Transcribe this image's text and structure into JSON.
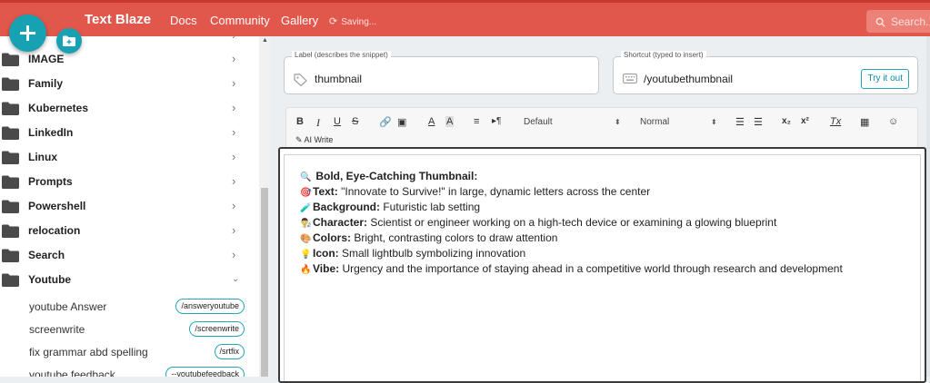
{
  "header": {
    "brand": "Text Blaze",
    "nav": [
      "Docs",
      "Community",
      "Gallery"
    ],
    "status": "Saving...",
    "search_placeholder": "Search..."
  },
  "sidebar": {
    "folders": [
      {
        "label": "IMAGE",
        "expanded": false
      },
      {
        "label": "Family",
        "expanded": false
      },
      {
        "label": "Kubernetes",
        "expanded": false
      },
      {
        "label": "LinkedIn",
        "expanded": false
      },
      {
        "label": "Linux",
        "expanded": false
      },
      {
        "label": "Prompts",
        "expanded": false
      },
      {
        "label": "Powershell",
        "expanded": false
      },
      {
        "label": "relocation",
        "expanded": false
      },
      {
        "label": "Search",
        "expanded": false
      },
      {
        "label": "Youtube",
        "expanded": true
      }
    ],
    "snippets": [
      {
        "label": "youtube Answer",
        "shortcut": "/answeryoutube"
      },
      {
        "label": "screenwrite",
        "shortcut": "/screenwrite"
      },
      {
        "label": "fix grammar abd spelling",
        "shortcut": "/srtfix"
      },
      {
        "label": "youtube feedback",
        "shortcut": "--youtubefeedback"
      }
    ]
  },
  "snippet_form": {
    "label_legend": "Label (describes the snippet)",
    "label_value": "thumbnail",
    "shortcut_legend": "Shortcut (typed to insert)",
    "shortcut_value": "/youtubethumbnail",
    "try_button": "Try it out"
  },
  "toolbar": {
    "font_select": "Default",
    "size_select": "Normal",
    "ai_write": "AI Write",
    "buttons": [
      "B",
      "I",
      "U",
      "S",
      "x₂",
      "x²",
      "Tx"
    ]
  },
  "editor": {
    "heading_emoji": "🔍",
    "heading": "Bold, Eye-Catching Thumbnail:",
    "lines": [
      {
        "emoji": "🎯",
        "key": "Text:",
        "value": " \"Innovate to Survive!\" in large, dynamic letters across the center"
      },
      {
        "emoji": "🧪",
        "key": "Background:",
        "value": " Futuristic lab setting"
      },
      {
        "emoji": "👨‍🔬",
        "key": "Character:",
        "value": " Scientist or engineer working on a high-tech device or examining a glowing blueprint"
      },
      {
        "emoji": "🎨",
        "key": "Colors:",
        "value": " Bright, contrasting colors to draw attention"
      },
      {
        "emoji": "💡",
        "key": "Icon:",
        "value": " Small lightbulb symbolizing innovation"
      },
      {
        "emoji": "🔥",
        "key": "Vibe:",
        "value": " Urgency and the importance of staying ahead in a competitive world through research and development"
      }
    ]
  },
  "colors": {
    "brand_red": "#e2574c",
    "accent_teal": "#16a2b3"
  }
}
